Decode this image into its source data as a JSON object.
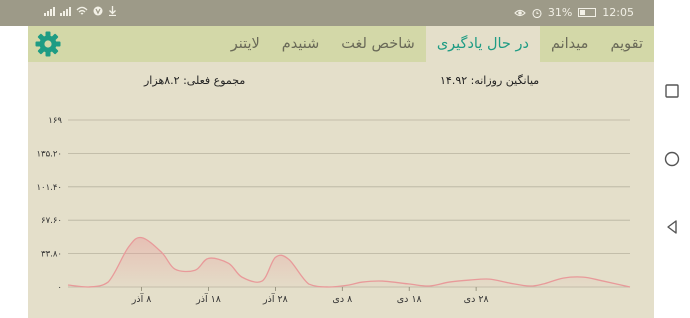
{
  "status_bar": {
    "time": "12:05",
    "battery_percent": "31%",
    "battery_level": 0.31,
    "icons_left": [
      "signal-icon",
      "signal-icon",
      "wifi-icon",
      "vpn-icon",
      "download-icon"
    ],
    "icons_right": [
      "eye-icon",
      "alarm-icon",
      "battery-icon"
    ]
  },
  "tabs": [
    {
      "label": "تقویم",
      "active": false
    },
    {
      "label": "میدانم",
      "active": false
    },
    {
      "label": "در حال یادگیری",
      "active": true
    },
    {
      "label": "شاخص لغت",
      "active": false
    },
    {
      "label": "شنیدم",
      "active": false
    },
    {
      "label": "لایتنر",
      "active": false
    }
  ],
  "stats": {
    "daily_average": "میانگین روزانه: ۱۴.۹۲",
    "total": "مجموع فعلی: ۸.۲هزار"
  },
  "colors": {
    "accent": "#1e9c84",
    "tabbar": "#d3d8a8",
    "background": "#e4dfca",
    "line": "#e89a9a"
  },
  "chart_data": {
    "type": "area",
    "y_tick_labels": [
      "۱۶۹",
      "۱۳۵.۲۰",
      "۱۰۱.۴۰",
      "۶۷.۶۰",
      "۳۳.۸۰",
      "۰"
    ],
    "y_tick_values": [
      169,
      135.2,
      101.4,
      67.6,
      33.8,
      0
    ],
    "ylim": [
      0,
      169
    ],
    "x_tick_labels": [
      "۸ آذر",
      "۱۸ آذر",
      "۲۸ آذر",
      "۸ دی",
      "۱۸ دی",
      "۲۸ دی"
    ],
    "x_tick_values": [
      0,
      10,
      20,
      30,
      40,
      50
    ],
    "xlim": [
      -11,
      73
    ],
    "grid": true,
    "series": [
      {
        "x": [
          -11,
          -8,
          -5,
          -2,
          0,
          3,
          5,
          8,
          10,
          13,
          15,
          18,
          20,
          22,
          25,
          28,
          31,
          33,
          36,
          40,
          43,
          46,
          49,
          52,
          55,
          58,
          60,
          63,
          66,
          69,
          73
        ],
        "values": [
          2,
          0,
          5,
          40,
          50,
          35,
          18,
          17,
          29,
          24,
          10,
          6,
          30,
          28,
          3,
          0,
          2,
          5,
          6,
          3,
          1,
          5,
          7,
          8,
          4,
          1,
          3,
          9,
          10,
          6,
          0
        ]
      }
    ]
  }
}
